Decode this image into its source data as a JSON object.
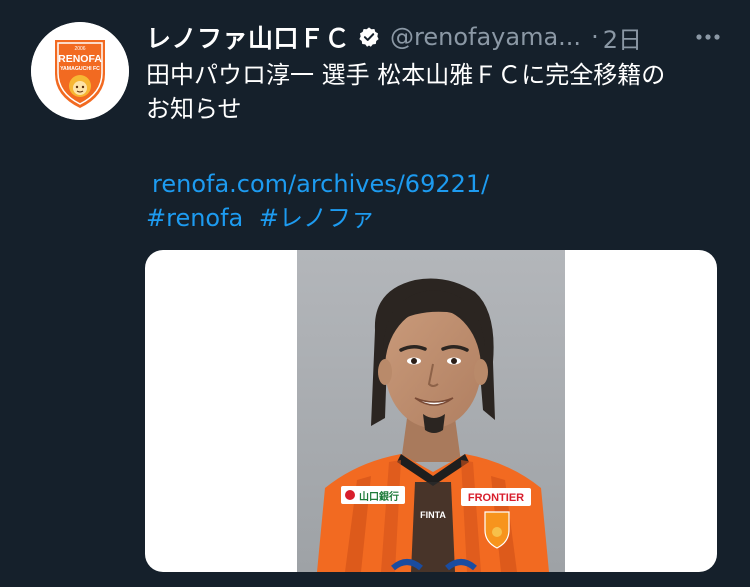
{
  "tweet": {
    "display_name": "レノファ山口ＦＣ",
    "handle": "@renofayama...",
    "separator": "·",
    "time": "2日",
    "text_line1": "田中パウロ淳一 選手 松本山雅ＦＣに完全移籍の",
    "text_line2": "お知らせ",
    "link": "renofa.com/archives/69221/",
    "hashtags": [
      "#renofa",
      "#レノファ"
    ]
  },
  "avatar": {
    "crest_text_top": "RENOFA",
    "crest_text_bottom": "YAMAGUCHI FC",
    "crest_year": "2006"
  },
  "photo": {
    "sponsor_left": "山口銀行",
    "sponsor_right": "FRONTIER",
    "kit_brand": "FINTA"
  },
  "colors": {
    "background": "#15202b",
    "link": "#1d9bf0",
    "secondary_text": "#8b98a5",
    "club_orange": "#f26a21"
  },
  "icons": {
    "verified": "verified-badge-icon",
    "more": "more-horizontal-icon"
  }
}
